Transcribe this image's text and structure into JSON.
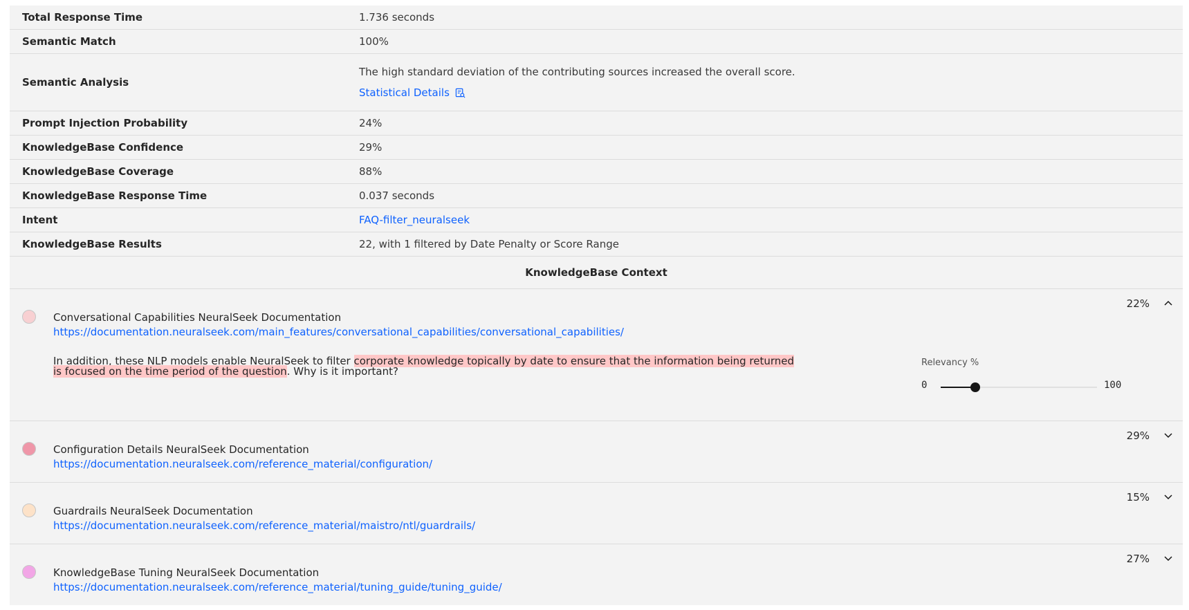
{
  "metrics": [
    {
      "label": "Total Response Time",
      "value": "1.736 seconds"
    },
    {
      "label": "Semantic Match",
      "value": "100%"
    },
    {
      "label": "Semantic Analysis",
      "value": "The high standard deviation of the contributing sources increased the overall score.",
      "link": "Statistical Details"
    },
    {
      "label": "Prompt Injection Probability",
      "value": "24%"
    },
    {
      "label": "KnowledgeBase Confidence",
      "value": "29%"
    },
    {
      "label": "KnowledgeBase Coverage",
      "value": "88%"
    },
    {
      "label": "KnowledgeBase Response Time",
      "value": "0.037 seconds"
    },
    {
      "label": "Intent",
      "value": "FAQ-filter_neuralseek"
    },
    {
      "label": "KnowledgeBase Results",
      "value": "22, with 1 filtered by Date Penalty or Score Range"
    }
  ],
  "context_heading": "KnowledgeBase Context",
  "sources": [
    {
      "title": "Conversational Capabilities NeuralSeek Documentation",
      "url": "https://documentation.neuralseek.com/main_features/conversational_capabilities/conversational_capabilities/",
      "percent": "22%",
      "dot_color": "#f8d0d2",
      "expanded": true,
      "snippet_pre": "In addition, these NLP models enable NeuralSeek to filter ",
      "snippet_highlight": "corporate knowledge topically by date to ensure that the information being returned is focused on the time period of the question",
      "snippet_post": ". Why is it important?",
      "relevancy_label": "Relevancy %",
      "relevancy_min": "0",
      "relevancy_max": "100",
      "relevancy_value": 22
    },
    {
      "title": "Configuration Details NeuralSeek Documentation",
      "url": "https://documentation.neuralseek.com/reference_material/configuration/",
      "percent": "29%",
      "dot_color": "#ef96a8"
    },
    {
      "title": "Guardrails NeuralSeek Documentation",
      "url": "https://documentation.neuralseek.com/reference_material/maistro/ntl/guardrails/",
      "percent": "15%",
      "dot_color": "#fde2c8"
    },
    {
      "title": "KnowledgeBase Tuning NeuralSeek Documentation",
      "url": "https://documentation.neuralseek.com/reference_material/tuning_guide/tuning_guide/",
      "percent": "27%",
      "dot_color": "#f2a6e6"
    }
  ],
  "icons": {
    "stat_details": "document-search-icon",
    "expanded": "chevron-up-icon",
    "collapsed": "chevron-down-icon"
  }
}
